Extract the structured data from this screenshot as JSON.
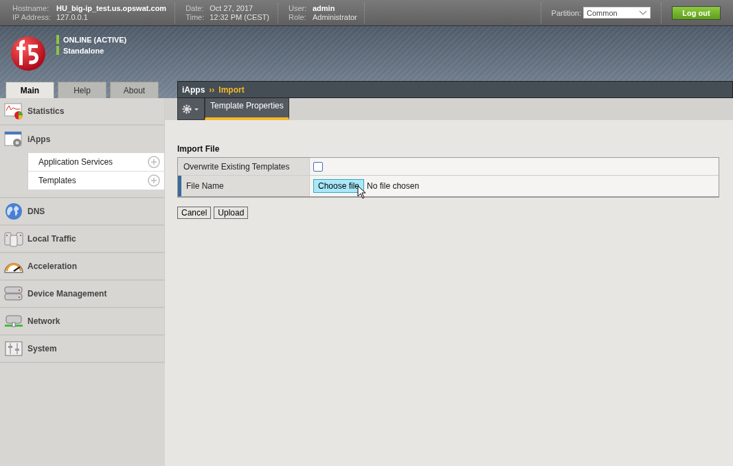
{
  "header": {
    "fields": [
      {
        "label": "Hostname:",
        "value": "HU_big-ip_test.us.opswat.com",
        "bold": true
      },
      {
        "label": "IP Address:",
        "value": "127.0.0.1",
        "bold": false
      },
      {
        "label": "Date:",
        "value": "Oct 27, 2017",
        "bold": false
      },
      {
        "label": "Time:",
        "value": "12:32 PM (CEST)",
        "bold": false
      },
      {
        "label": "User:",
        "value": "admin",
        "bold": true
      },
      {
        "label": "Role:",
        "value": "Administrator",
        "bold": false
      }
    ],
    "partition": {
      "label": "Partition:",
      "value": "Common"
    },
    "logout": "Log out"
  },
  "status": [
    "ONLINE (ACTIVE)",
    "Standalone"
  ],
  "tabs": [
    {
      "label": "Main",
      "selected": true
    },
    {
      "label": "Help",
      "selected": false
    },
    {
      "label": "About",
      "selected": false
    }
  ],
  "sidebar": {
    "items": [
      {
        "label": "Statistics",
        "expanded": false
      },
      {
        "label": "iApps",
        "expanded": true,
        "children": [
          {
            "label": "Application Services"
          },
          {
            "label": "Templates"
          }
        ]
      },
      {
        "label": "DNS",
        "expanded": false
      },
      {
        "label": "Local Traffic",
        "expanded": false
      },
      {
        "label": "Acceleration",
        "expanded": false
      },
      {
        "label": "Device Management",
        "expanded": false
      },
      {
        "label": "Network",
        "expanded": false
      },
      {
        "label": "System",
        "expanded": false
      }
    ]
  },
  "breadcrumb": {
    "section": "iApps",
    "separator": "››",
    "page": "Import"
  },
  "subtabs": [
    {
      "label": "Template Properties",
      "selected": true
    }
  ],
  "form": {
    "title": "Import File",
    "overwrite": {
      "label": "Overwrite Existing Templates",
      "checked": false
    },
    "file": {
      "label": "File Name",
      "button": "Choose file",
      "status": "No file chosen"
    },
    "buttons": [
      "Cancel",
      "Upload"
    ]
  }
}
